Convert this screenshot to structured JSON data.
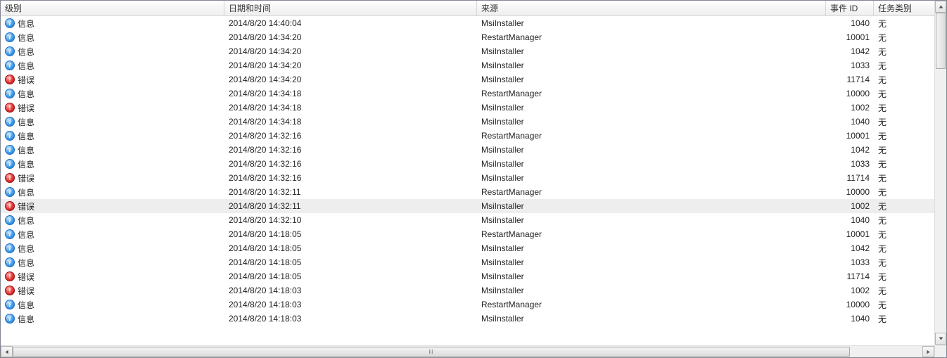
{
  "columns": {
    "level": "级别",
    "date": "日期和时间",
    "source": "来源",
    "eventId": "事件 ID",
    "task": "任务类别"
  },
  "levelLabels": {
    "info": "信息",
    "error": "错误"
  },
  "rows": [
    {
      "level": "info",
      "date": "2014/8/20 14:40:04",
      "source": "MsiInstaller",
      "eventId": 1040,
      "task": "无",
      "selected": false
    },
    {
      "level": "info",
      "date": "2014/8/20 14:34:20",
      "source": "RestartManager",
      "eventId": 10001,
      "task": "无",
      "selected": false
    },
    {
      "level": "info",
      "date": "2014/8/20 14:34:20",
      "source": "MsiInstaller",
      "eventId": 1042,
      "task": "无",
      "selected": false
    },
    {
      "level": "info",
      "date": "2014/8/20 14:34:20",
      "source": "MsiInstaller",
      "eventId": 1033,
      "task": "无",
      "selected": false
    },
    {
      "level": "error",
      "date": "2014/8/20 14:34:20",
      "source": "MsiInstaller",
      "eventId": 11714,
      "task": "无",
      "selected": false
    },
    {
      "level": "info",
      "date": "2014/8/20 14:34:18",
      "source": "RestartManager",
      "eventId": 10000,
      "task": "无",
      "selected": false
    },
    {
      "level": "error",
      "date": "2014/8/20 14:34:18",
      "source": "MsiInstaller",
      "eventId": 1002,
      "task": "无",
      "selected": false
    },
    {
      "level": "info",
      "date": "2014/8/20 14:34:18",
      "source": "MsiInstaller",
      "eventId": 1040,
      "task": "无",
      "selected": false
    },
    {
      "level": "info",
      "date": "2014/8/20 14:32:16",
      "source": "RestartManager",
      "eventId": 10001,
      "task": "无",
      "selected": false
    },
    {
      "level": "info",
      "date": "2014/8/20 14:32:16",
      "source": "MsiInstaller",
      "eventId": 1042,
      "task": "无",
      "selected": false
    },
    {
      "level": "info",
      "date": "2014/8/20 14:32:16",
      "source": "MsiInstaller",
      "eventId": 1033,
      "task": "无",
      "selected": false
    },
    {
      "level": "error",
      "date": "2014/8/20 14:32:16",
      "source": "MsiInstaller",
      "eventId": 11714,
      "task": "无",
      "selected": false
    },
    {
      "level": "info",
      "date": "2014/8/20 14:32:11",
      "source": "RestartManager",
      "eventId": 10000,
      "task": "无",
      "selected": false
    },
    {
      "level": "error",
      "date": "2014/8/20 14:32:11",
      "source": "MsiInstaller",
      "eventId": 1002,
      "task": "无",
      "selected": true
    },
    {
      "level": "info",
      "date": "2014/8/20 14:32:10",
      "source": "MsiInstaller",
      "eventId": 1040,
      "task": "无",
      "selected": false
    },
    {
      "level": "info",
      "date": "2014/8/20 14:18:05",
      "source": "RestartManager",
      "eventId": 10001,
      "task": "无",
      "selected": false
    },
    {
      "level": "info",
      "date": "2014/8/20 14:18:05",
      "source": "MsiInstaller",
      "eventId": 1042,
      "task": "无",
      "selected": false
    },
    {
      "level": "info",
      "date": "2014/8/20 14:18:05",
      "source": "MsiInstaller",
      "eventId": 1033,
      "task": "无",
      "selected": false
    },
    {
      "level": "error",
      "date": "2014/8/20 14:18:05",
      "source": "MsiInstaller",
      "eventId": 11714,
      "task": "无",
      "selected": false
    },
    {
      "level": "error",
      "date": "2014/8/20 14:18:03",
      "source": "MsiInstaller",
      "eventId": 1002,
      "task": "无",
      "selected": false
    },
    {
      "level": "info",
      "date": "2014/8/20 14:18:03",
      "source": "RestartManager",
      "eventId": 10000,
      "task": "无",
      "selected": false
    },
    {
      "level": "info",
      "date": "2014/8/20 14:18:03",
      "source": "MsiInstaller",
      "eventId": 1040,
      "task": "无",
      "selected": false
    }
  ]
}
